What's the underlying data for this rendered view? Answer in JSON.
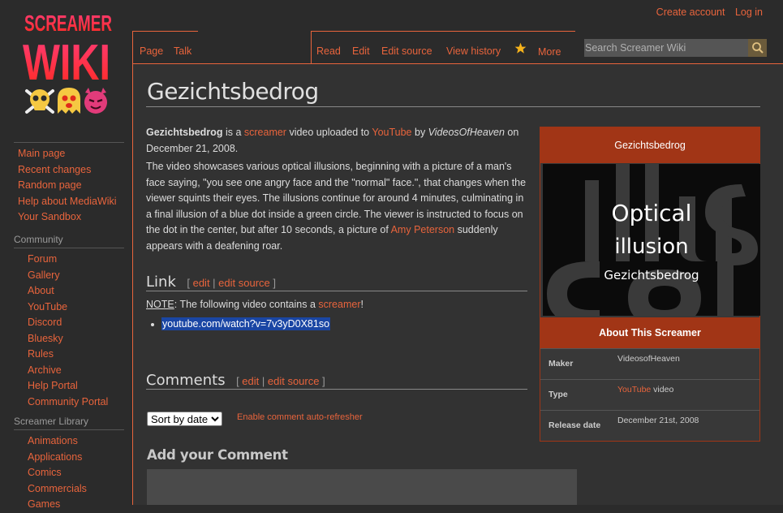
{
  "logo": {
    "line1": "SCREAMER",
    "line2": "WIKI"
  },
  "personal": {
    "create_account": "Create account",
    "login": "Log in"
  },
  "tabs": {
    "page": "Page",
    "talk": "Talk",
    "read": "Read",
    "edit": "Edit",
    "edit_source": "Edit source",
    "view_history": "View history",
    "more": "More"
  },
  "search": {
    "placeholder": "Search Screamer Wiki"
  },
  "sidebar": {
    "main": [
      "Main page",
      "Recent changes",
      "Random page",
      "Help about MediaWiki",
      "Your Sandbox"
    ],
    "community_heading": "Community",
    "community": [
      "Forum",
      "Gallery",
      "About",
      "YouTube",
      "Discord",
      "Bluesky",
      "Rules",
      "Archive",
      "Help Portal",
      "Community Portal"
    ],
    "library_heading": "Screamer Library",
    "library": [
      "Animations",
      "Applications",
      "Comics",
      "Commercials",
      "Games"
    ]
  },
  "article": {
    "title": "Gezichtsbedrog",
    "p1": {
      "bold": "Gezichtsbedrog",
      "t1": " is a ",
      "link1": "screamer",
      "t2": " video uploaded to ",
      "link2": "YouTube",
      "t3": " by ",
      "italic": "VideosOfHeaven",
      "t4": " on December 21, 2008."
    },
    "p2": {
      "t1": "The video showcases various optical illusions, beginning with a picture of a man's face saying, \"you see one angry face and the \"normal\" face.\", that changes when the viewer squints their eyes. The illusions continue for around 4 minutes, culminating in a final illusion of a blue dot inside a green circle. The viewer is instructed to focus on the dot in the center, but after 10 seconds, a picture of ",
      "link": "Amy Peterson",
      "t2": " suddenly appears with a deafening roar."
    },
    "link_heading": "Link",
    "comments_heading": "Comments",
    "edit": "edit",
    "edit_source": "edit source",
    "note_label": "NOTE",
    "note_text": ": The following video contains a ",
    "note_link": "screamer",
    "note_end": "!",
    "video_link": "youtube.com/watch?v=7v3yD0X81so"
  },
  "comments": {
    "sort_selected": "Sort by date",
    "auto_refresher": "Enable comment auto-refresher",
    "add_comment": "Add your Comment"
  },
  "infobox": {
    "title": "Gezichtsbedrog",
    "image_text": {
      "line1": "Optical",
      "line2": "illusion",
      "line3": "Gezichtsbedrog"
    },
    "about_heading": "About This Screamer",
    "maker_label": "Maker",
    "maker_value": "VideosofHeaven",
    "type_label": "Type",
    "type_link": "YouTube",
    "type_rest": " video",
    "release_label": "Release date",
    "release_value": "December 21st, 2008"
  },
  "colors": {
    "accent": "#e8643c",
    "infobox_header": "#a13516",
    "selection": "#1a46a4"
  }
}
